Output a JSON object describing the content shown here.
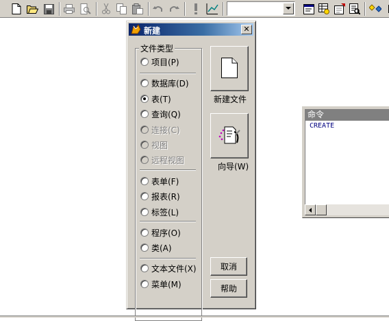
{
  "toolbar": {
    "buttons": [
      {
        "icon": "new-file-icon"
      },
      {
        "icon": "open-folder-icon"
      },
      {
        "icon": "save-icon"
      },
      {
        "icon": "print-icon"
      },
      {
        "icon": "print-preview-icon"
      },
      {
        "icon": "cut-icon"
      },
      {
        "icon": "copy-icon"
      },
      {
        "icon": "paste-icon"
      },
      {
        "icon": "undo-icon"
      },
      {
        "icon": "redo-icon"
      },
      {
        "icon": "run-icon"
      },
      {
        "icon": "modify-form-icon"
      },
      {
        "icon": "command-window-icon"
      },
      {
        "icon": "database-icon"
      },
      {
        "icon": "properties-icon"
      },
      {
        "icon": "code-window-icon"
      },
      {
        "icon": "form-controls-icon"
      }
    ],
    "combo_value": ""
  },
  "dialog": {
    "title": "新建",
    "close_label": "✕",
    "group_label": "文件类型",
    "options": [
      {
        "label": "项目(P)",
        "checked": false,
        "disabled": false
      },
      {
        "label": "数据库(D)",
        "checked": false,
        "disabled": false
      },
      {
        "label": "表(T)",
        "checked": true,
        "disabled": false
      },
      {
        "label": "查询(Q)",
        "checked": false,
        "disabled": false
      },
      {
        "label": "连接(C)",
        "checked": false,
        "disabled": true
      },
      {
        "label": "视图",
        "checked": false,
        "disabled": true
      },
      {
        "label": "远程视图",
        "checked": false,
        "disabled": true
      },
      {
        "label": "表单(F)",
        "checked": false,
        "disabled": false
      },
      {
        "label": "报表(R)",
        "checked": false,
        "disabled": false
      },
      {
        "label": "标签(L)",
        "checked": false,
        "disabled": false
      },
      {
        "label": "程序(O)",
        "checked": false,
        "disabled": false
      },
      {
        "label": "类(A)",
        "checked": false,
        "disabled": false
      },
      {
        "label": "文本文件(X)",
        "checked": false,
        "disabled": false
      },
      {
        "label": "菜单(M)",
        "checked": false,
        "disabled": false
      }
    ],
    "new_file_label": "新建文件",
    "wizard_label": "向导(W)",
    "cancel_label": "取消",
    "help_label": "帮助"
  },
  "command_window": {
    "title": "命令",
    "text": "CREATE"
  }
}
